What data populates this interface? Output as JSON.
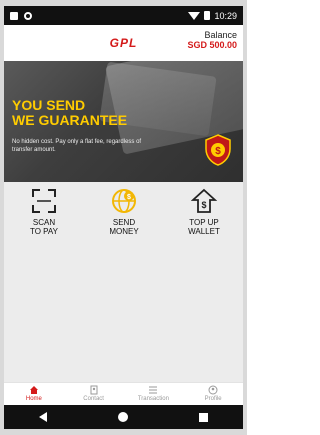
{
  "status_bar": {
    "time": "10:29"
  },
  "header": {
    "brand": "GPL",
    "balance_label": "Balance",
    "balance_value": "SGD 500.00"
  },
  "banner": {
    "title_line1": "YOU SEND",
    "title_line2": "WE GUARANTEE",
    "subtitle": "No hidden cost. Pay only a flat fee, regardless of transfer amount."
  },
  "actions": [
    {
      "line1": "SCAN",
      "line2": "TO PAY",
      "icon": "scan-icon"
    },
    {
      "line1": "SEND",
      "line2": "MONEY",
      "icon": "globe-dollar-icon"
    },
    {
      "line1": "TOP UP",
      "line2": "WALLET",
      "icon": "top-up-icon"
    }
  ],
  "bottom_nav": [
    {
      "label": "Home",
      "icon": "home-icon",
      "active": true
    },
    {
      "label": "Contact",
      "icon": "contact-icon",
      "active": false
    },
    {
      "label": "Transaction",
      "icon": "list-icon",
      "active": false
    },
    {
      "label": "Profile",
      "icon": "profile-icon",
      "active": false
    }
  ],
  "colors": {
    "accent": "#d41b1b",
    "banner_title": "#ffcc00",
    "bg": "#ececec"
  }
}
